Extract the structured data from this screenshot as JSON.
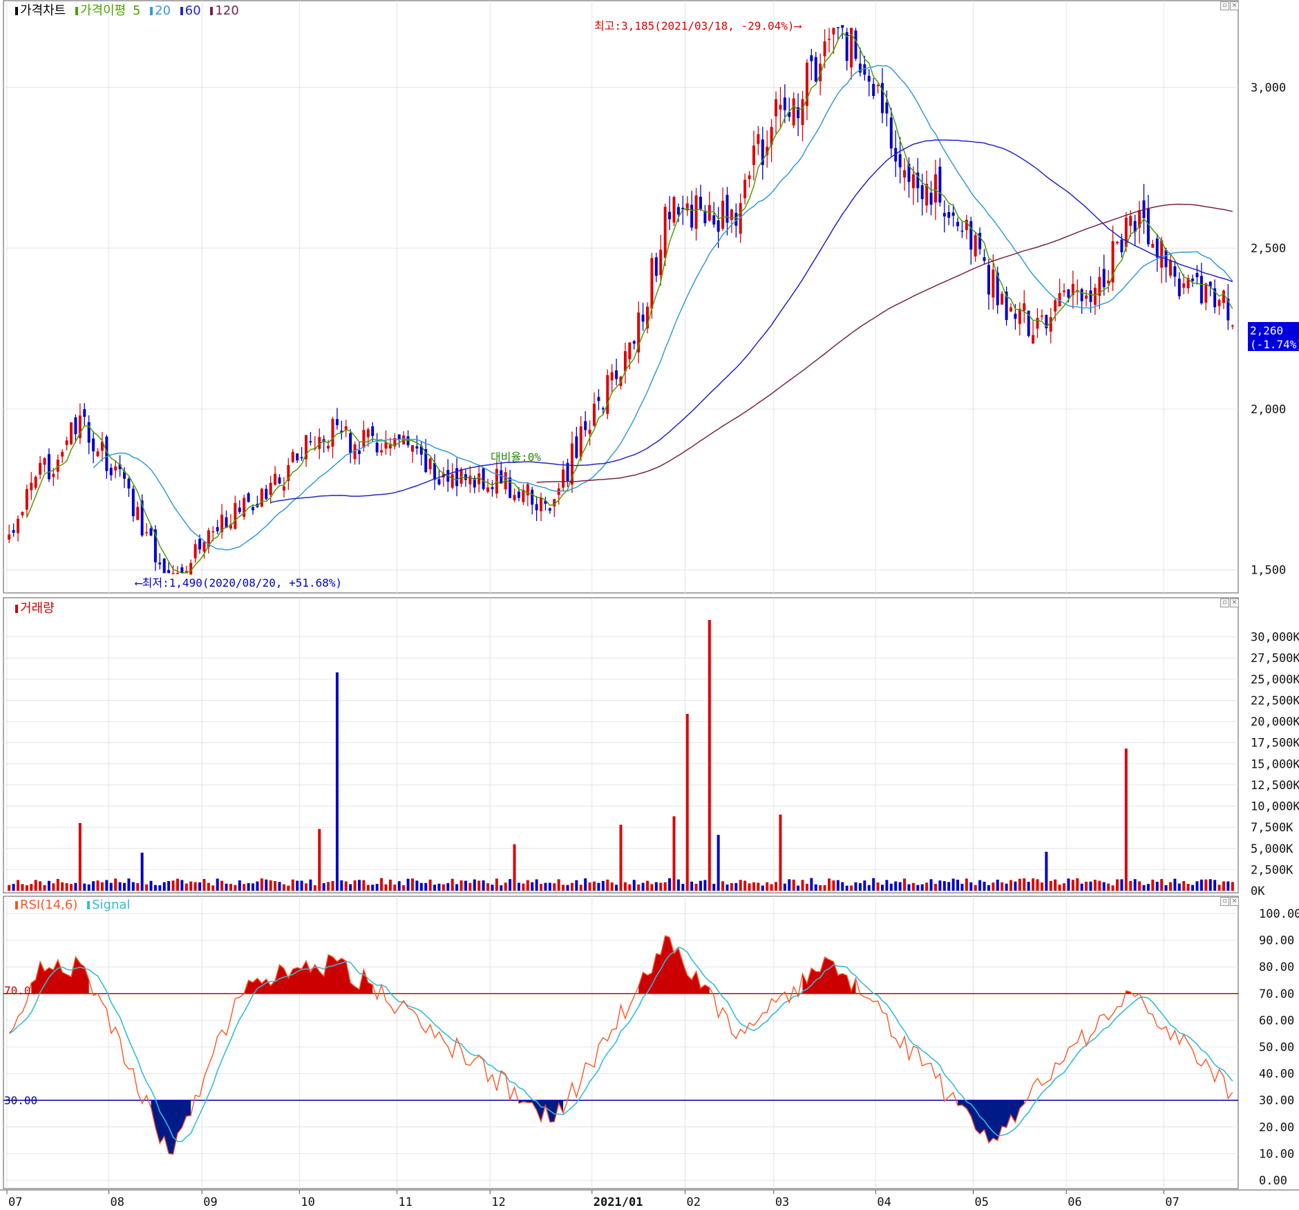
{
  "price_panel": {
    "title": "가격차트",
    "ma_label": "가격이평",
    "ma_periods": [
      "5",
      "20",
      "60",
      "120"
    ],
    "ma_colors": {
      "5": "#4aa000",
      "20": "#3399dd",
      "60": "#2222cc",
      "120": "#772244"
    },
    "high_annotation": "최고:3,185(2021/03/18, -29.04%)⟶",
    "low_annotation": "⟵최저:1,490(2020/08/20, +51.68%)",
    "volume_ratio_annotation": "대비율:0%",
    "current_price": "2,260",
    "current_change": "(-1.74%)",
    "y_ticks": [
      "3,000",
      "2,500",
      "2,000",
      "1,500"
    ]
  },
  "volume_panel": {
    "title": "거래량",
    "y_ticks": [
      "30,000K",
      "27,500K",
      "25,000K",
      "22,500K",
      "20,000K",
      "17,500K",
      "15,000K",
      "12,500K",
      "10,000K",
      "7,500K",
      "5,000K",
      "2,500K",
      "0K"
    ]
  },
  "rsi_panel": {
    "title": "RSI(14,6)",
    "signal_label": "Signal",
    "y_ticks": [
      "100.00",
      "90.00",
      "80.00",
      "70.00",
      "60.00",
      "50.00",
      "40.00",
      "30.00",
      "20.00",
      "10.00",
      "0.00"
    ],
    "upper_line_label": "70.00",
    "lower_line_label": "30.00"
  },
  "x_axis": {
    "labels": [
      "07",
      "08",
      "09",
      "10",
      "11",
      "12",
      "2021/01",
      "02",
      "03",
      "04",
      "05",
      "06",
      "07"
    ]
  },
  "colors": {
    "up": "#dd0000",
    "down": "#0000cc",
    "rsi": "#ff5522",
    "signal": "#33bbdd",
    "overbought_fill": "#cc0000",
    "oversold_fill": "#001a88",
    "current_price_bg": "#0000dd"
  },
  "chart_data": [
    {
      "type": "candlestick",
      "title": "가격차트",
      "ylim": [
        1450,
        3250
      ],
      "x": [
        "2020/07",
        "2020/08",
        "2020/09",
        "2020/10",
        "2020/11",
        "2020/12",
        "2021/01",
        "2021/02",
        "2021/03",
        "2021/04",
        "2021/05",
        "2021/06",
        "2021/07"
      ],
      "close_anchors": [
        {
          "date": "2020/07/01",
          "close": 1610
        },
        {
          "date": "2020/07/23",
          "close": 1980
        },
        {
          "date": "2020/08/20",
          "close": 1490
        },
        {
          "date": "2020/10/13",
          "close": 1950
        },
        {
          "date": "2020/11/16",
          "close": 1800
        },
        {
          "date": "2020/12/21",
          "close": 1720
        },
        {
          "date": "2021/01/12",
          "close": 2180
        },
        {
          "date": "2021/01/26",
          "close": 2590
        },
        {
          "date": "2021/02/15",
          "close": 2620
        },
        {
          "date": "2021/03/18",
          "close": 3185
        },
        {
          "date": "2021/04/02",
          "close": 2920
        },
        {
          "date": "2021/04/16",
          "close": 2700
        },
        {
          "date": "2021/05/20",
          "close": 2230
        },
        {
          "date": "2021/06/22",
          "close": 2550
        },
        {
          "date": "2021/07/22",
          "close": 2260
        }
      ],
      "high": 3185,
      "low": 1490,
      "last": 2260,
      "change_pct": -1.74
    },
    {
      "type": "bar",
      "title": "거래량",
      "unit": "K",
      "ylim": [
        0,
        32500
      ],
      "spikes": [
        {
          "date": "2020/07/23",
          "value": 8000
        },
        {
          "date": "2020/08/12",
          "value": 4500
        },
        {
          "date": "2020/10/07",
          "value": 7300
        },
        {
          "date": "2020/10/13",
          "value": 25800
        },
        {
          "date": "2020/12/08",
          "value": 5500
        },
        {
          "date": "2021/01/11",
          "value": 7800
        },
        {
          "date": "2021/01/27",
          "value": 8800
        },
        {
          "date": "2021/02/01",
          "value": 20900
        },
        {
          "date": "2021/02/08",
          "value": 32000
        },
        {
          "date": "2021/02/10",
          "value": 6600
        },
        {
          "date": "2021/03/02",
          "value": 9000
        },
        {
          "date": "2021/05/25",
          "value": 4600
        },
        {
          "date": "2021/06/18",
          "value": 16800
        }
      ]
    },
    {
      "type": "line",
      "title": "RSI(14,6)",
      "ylim": [
        0,
        100
      ],
      "series": [
        {
          "name": "RSI(14,6)"
        },
        {
          "name": "Signal"
        }
      ],
      "levels": [
        70,
        30
      ],
      "anchors": [
        {
          "date": "2020/07/01",
          "rsi": 55
        },
        {
          "date": "2020/07/10",
          "rsi": 82
        },
        {
          "date": "2020/07/24",
          "rsi": 80
        },
        {
          "date": "2020/08/20",
          "rsi": 10
        },
        {
          "date": "2020/09/15",
          "rsi": 75
        },
        {
          "date": "2020/10/13",
          "rsi": 82
        },
        {
          "date": "2020/12/21",
          "rsi": 22
        },
        {
          "date": "2021/01/26",
          "rsi": 91
        },
        {
          "date": "2021/02/15",
          "rsi": 55
        },
        {
          "date": "2021/03/18",
          "rsi": 82
        },
        {
          "date": "2021/04/27",
          "rsi": 28
        },
        {
          "date": "2021/05/06",
          "rsi": 14
        },
        {
          "date": "2021/06/18",
          "rsi": 71
        },
        {
          "date": "2021/07/22",
          "rsi": 33
        }
      ]
    }
  ]
}
